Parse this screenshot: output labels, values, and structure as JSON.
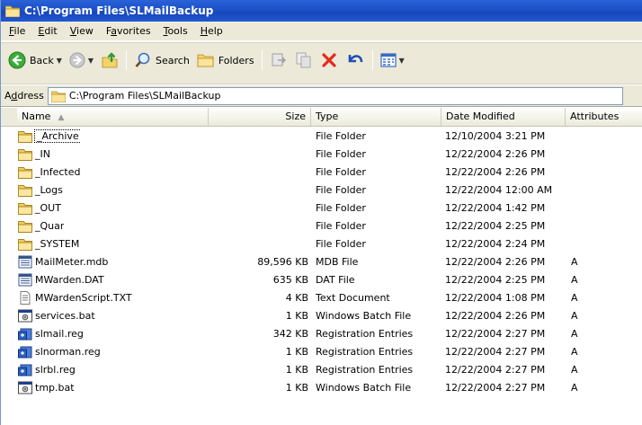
{
  "window": {
    "title": "C:\\Program Files\\SLMailBackup"
  },
  "menubar": {
    "items": [
      {
        "u": "F",
        "rest": "ile"
      },
      {
        "u": "E",
        "rest": "dit"
      },
      {
        "u": "V",
        "rest": "iew"
      },
      {
        "pre": "F",
        "u": "a",
        "rest": "vorites"
      },
      {
        "u": "T",
        "rest": "ools"
      },
      {
        "u": "H",
        "rest": "elp"
      }
    ]
  },
  "toolbar": {
    "back_label": "Back",
    "search_label": "Search",
    "folders_label": "Folders"
  },
  "address": {
    "label_pre": "A",
    "label_u": "d",
    "label_rest": "dress",
    "value": "C:\\Program Files\\SLMailBackup"
  },
  "columns": {
    "name": "Name",
    "size": "Size",
    "type": "Type",
    "date": "Date Modified",
    "attributes": "Attributes"
  },
  "files": [
    {
      "name": "_Archive",
      "size": "",
      "type": "File Folder",
      "date": "12/10/2004 3:21 PM",
      "attr": "",
      "icon": "folder-icon"
    },
    {
      "name": "_IN",
      "size": "",
      "type": "File Folder",
      "date": "12/22/2004 2:26 PM",
      "attr": "",
      "icon": "folder-icon"
    },
    {
      "name": "_Infected",
      "size": "",
      "type": "File Folder",
      "date": "12/22/2004 2:26 PM",
      "attr": "",
      "icon": "folder-icon"
    },
    {
      "name": "_Logs",
      "size": "",
      "type": "File Folder",
      "date": "12/22/2004 12:00 AM",
      "attr": "",
      "icon": "folder-icon"
    },
    {
      "name": "_OUT",
      "size": "",
      "type": "File Folder",
      "date": "12/22/2004 1:42 PM",
      "attr": "",
      "icon": "folder-icon"
    },
    {
      "name": "_Quar",
      "size": "",
      "type": "File Folder",
      "date": "12/22/2004 2:25 PM",
      "attr": "",
      "icon": "folder-icon"
    },
    {
      "name": "_SYSTEM",
      "size": "",
      "type": "File Folder",
      "date": "12/22/2004 2:24 PM",
      "attr": "",
      "icon": "folder-icon"
    },
    {
      "name": "MailMeter.mdb",
      "size": "89,596 KB",
      "type": "MDB File",
      "date": "12/22/2004 2:26 PM",
      "attr": "A",
      "icon": "data-file-icon"
    },
    {
      "name": "MWarden.DAT",
      "size": "635 KB",
      "type": "DAT File",
      "date": "12/22/2004 2:25 PM",
      "attr": "A",
      "icon": "data-file-icon"
    },
    {
      "name": "MWardenScript.TXT",
      "size": "4 KB",
      "type": "Text Document",
      "date": "12/22/2004 1:08 PM",
      "attr": "A",
      "icon": "text-file-icon"
    },
    {
      "name": "services.bat",
      "size": "1 KB",
      "type": "Windows Batch File",
      "date": "12/22/2004 2:26 PM",
      "attr": "A",
      "icon": "batch-file-icon"
    },
    {
      "name": "slmail.reg",
      "size": "342 KB",
      "type": "Registration Entries",
      "date": "12/22/2004 2:27 PM",
      "attr": "A",
      "icon": "registry-file-icon"
    },
    {
      "name": "slnorman.reg",
      "size": "1 KB",
      "type": "Registration Entries",
      "date": "12/22/2004 2:27 PM",
      "attr": "A",
      "icon": "registry-file-icon"
    },
    {
      "name": "slrbl.reg",
      "size": "1 KB",
      "type": "Registration Entries",
      "date": "12/22/2004 2:27 PM",
      "attr": "A",
      "icon": "registry-file-icon"
    },
    {
      "name": "tmp.bat",
      "size": "1 KB",
      "type": "Windows Batch File",
      "date": "12/22/2004 2:27 PM",
      "attr": "A",
      "icon": "batch-file-icon"
    }
  ]
}
